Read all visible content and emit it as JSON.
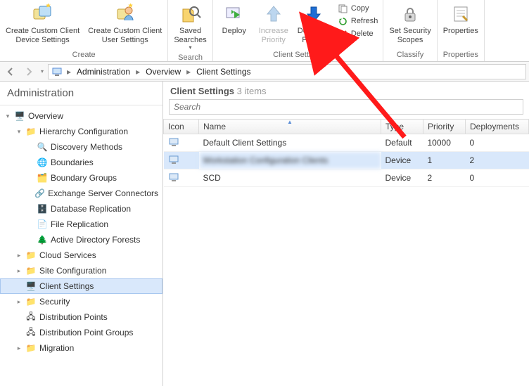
{
  "ribbon": {
    "groups": {
      "create": {
        "label": "Create",
        "btn_device": "Create Custom Client\nDevice Settings",
        "btn_user": "Create Custom Client\nUser Settings"
      },
      "search": {
        "label": "Search",
        "btn_saved": "Saved\nSearches"
      },
      "client_settings": {
        "label": "Client Settings",
        "btn_deploy": "Deploy",
        "btn_inc": "Increase\nPriority",
        "btn_dec": "Decrease\nPriority",
        "btn_copy": "Copy",
        "btn_refresh": "Refresh",
        "btn_delete": "Delete"
      },
      "classify": {
        "label": "Classify",
        "btn_scopes": "Set Security\nScopes"
      },
      "properties": {
        "label": "Properties",
        "btn_props": "Properties"
      }
    }
  },
  "breadcrumb": {
    "items": [
      "Administration",
      "Overview",
      "Client Settings"
    ]
  },
  "sidebar": {
    "title": "Administration",
    "overview": "Overview",
    "hierarchy": "Hierarchy Configuration",
    "discovery": "Discovery Methods",
    "boundaries": "Boundaries",
    "boundary_groups": "Boundary Groups",
    "exchange": "Exchange Server Connectors",
    "db_repl": "Database Replication",
    "file_repl": "File Replication",
    "ad_forests": "Active Directory Forests",
    "cloud": "Cloud Services",
    "site_config": "Site Configuration",
    "client_settings": "Client Settings",
    "security": "Security",
    "dist_points": "Distribution Points",
    "dist_groups": "Distribution Point Groups",
    "migration": "Migration"
  },
  "content": {
    "title": "Client Settings",
    "count": "3 items",
    "search_placeholder": "Search",
    "columns": {
      "icon": "Icon",
      "name": "Name",
      "type": "Type",
      "priority": "Priority",
      "deployments": "Deployments"
    },
    "rows": [
      {
        "name": "Default Client Settings",
        "type": "Default",
        "priority": "10000",
        "deployments": "0",
        "selected": false,
        "blur": false
      },
      {
        "name": "Workstation Configuration Clients",
        "type": "Device",
        "priority": "1",
        "deployments": "2",
        "selected": true,
        "blur": true
      },
      {
        "name": "SCD",
        "type": "Device",
        "priority": "2",
        "deployments": "0",
        "selected": false,
        "blur": false
      }
    ]
  }
}
